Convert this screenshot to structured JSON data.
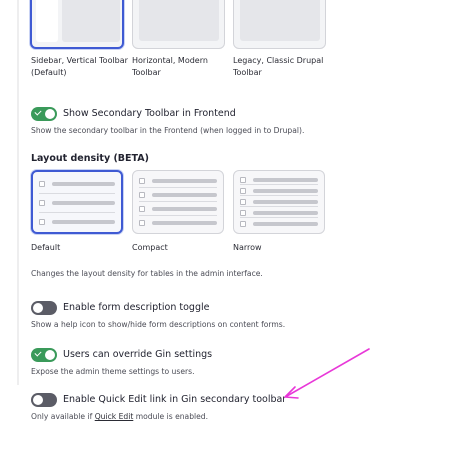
{
  "toolbar_options": [
    {
      "label_line1": "Sidebar, Vertical Toolbar",
      "label_line2": "(Default)",
      "selected": true
    },
    {
      "label_line1": "Horizontal, Modern",
      "label_line2": "Toolbar",
      "selected": false
    },
    {
      "label_line1": "Legacy, Classic Drupal",
      "label_line2": "Toolbar",
      "selected": false
    }
  ],
  "secondary_toolbar": {
    "label": "Show Secondary Toolbar in Frontend",
    "description": "Show the secondary toolbar in the Frontend (when logged in to Drupal).",
    "checked": true
  },
  "layout_density": {
    "title": "Layout density (BETA)",
    "options": [
      {
        "label": "Default",
        "selected": true
      },
      {
        "label": "Compact",
        "selected": false
      },
      {
        "label": "Narrow",
        "selected": false
      }
    ],
    "description": "Changes the layout density for tables in the admin interface."
  },
  "form_description_toggle": {
    "label": "Enable form description toggle",
    "description": "Show a help icon to show/hide form descriptions on content forms.",
    "checked": false
  },
  "override_settings": {
    "label": "Users can override Gin settings",
    "description": "Expose the admin theme settings to users.",
    "checked": true
  },
  "quick_edit": {
    "label": "Enable Quick Edit link in Gin secondary toolbar",
    "description_prefix": "Only available if ",
    "description_link": "Quick Edit",
    "description_suffix": " module is enabled.",
    "checked": false
  },
  "colors": {
    "accent": "#3f5ad3",
    "toggle_on": "#3a9a5a",
    "toggle_off": "#5b5c66",
    "annotation_arrow": "#e838d8"
  }
}
